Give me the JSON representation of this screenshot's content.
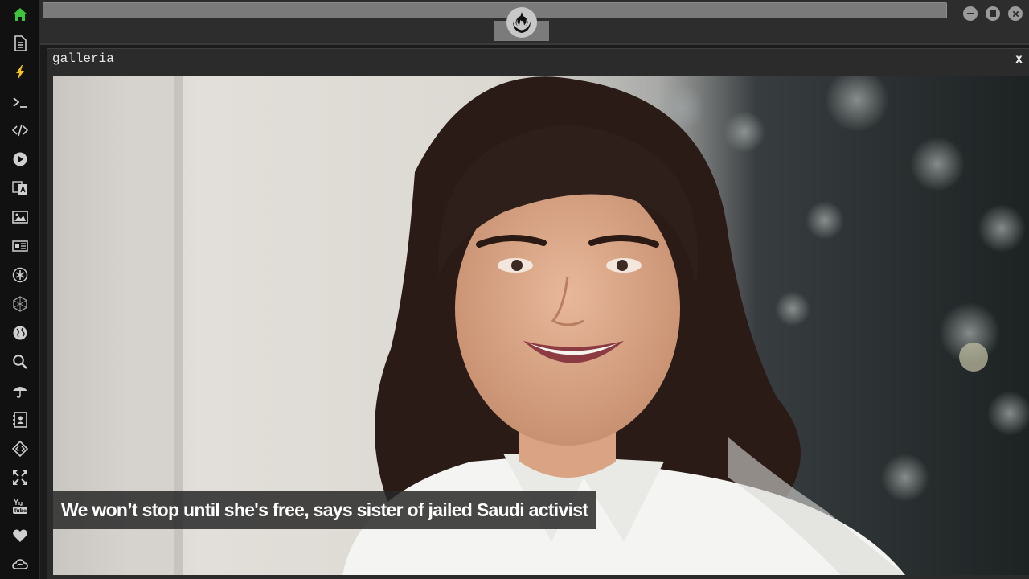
{
  "window": {
    "title": "galleria",
    "close_label": "x"
  },
  "gallery": {
    "caption": "We won’t stop until she's free, says sister of jailed Saudi activist"
  },
  "sidebar": {
    "items": [
      {
        "icon": "home-icon"
      },
      {
        "icon": "document-icon"
      },
      {
        "icon": "lightning-icon"
      },
      {
        "icon": "terminal-icon"
      },
      {
        "icon": "code-icon"
      },
      {
        "icon": "play-icon"
      },
      {
        "icon": "translate-icon"
      },
      {
        "icon": "image-icon"
      },
      {
        "icon": "newspaper-icon"
      },
      {
        "icon": "asterisk-icon"
      },
      {
        "icon": "hexagon-icon"
      },
      {
        "icon": "globe-icon"
      },
      {
        "icon": "search-icon"
      },
      {
        "icon": "umbrella-icon"
      },
      {
        "icon": "contact-book-icon"
      },
      {
        "icon": "diamond-code-icon"
      },
      {
        "icon": "expand-icon"
      },
      {
        "icon": "youtube-icon"
      },
      {
        "icon": "heart-icon"
      },
      {
        "icon": "cloud-icon"
      }
    ],
    "active_color": "#3ec53e",
    "icon_color": "#cfcfcf"
  },
  "topbar": {
    "logo": "rebel-alliance-icon"
  }
}
